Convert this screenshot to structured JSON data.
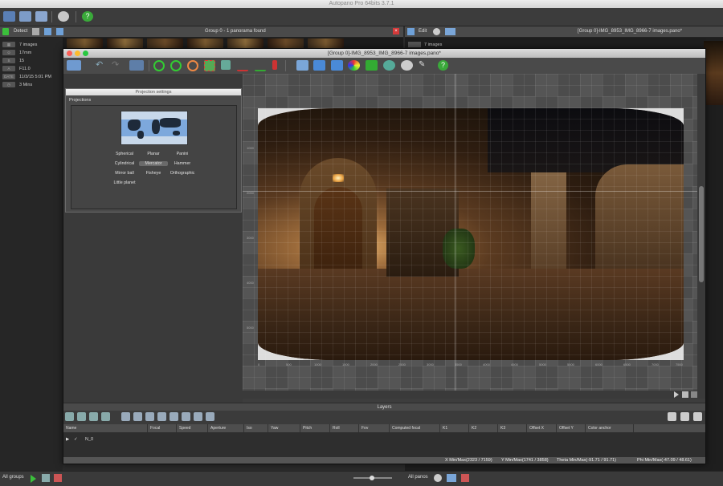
{
  "app": {
    "title": "Autopano Pro 64bits 3.7.1"
  },
  "left_pane": {
    "detect_label": "Detect",
    "group_title": "Group 0 - 1 panorama found",
    "info": [
      {
        "key": "IMG",
        "value": "7 images"
      },
      {
        "key": "F",
        "value": "17mm"
      },
      {
        "key": "ISO",
        "value": "15"
      },
      {
        "key": "f/",
        "value": "F11.0"
      },
      {
        "key": "DATE",
        "value": "11/3/15 5:01 PM"
      },
      {
        "key": "T",
        "value": "3 Mins"
      }
    ]
  },
  "right_pane": {
    "edit_label": "Edit",
    "title": "[Group 0]-IMG_8953_IMG_8966-7 images.pano*",
    "images": "7 images"
  },
  "editor": {
    "title": "[Group 0]-IMG_8953_IMG_8966-7 images.pano*"
  },
  "projection": {
    "panel_title": "Projection settings",
    "section": "Projections",
    "options": [
      "Spherical",
      "Planar",
      "Panini",
      "Cylindrical",
      "Mercator",
      "Hammer",
      "Mirror ball",
      "Fisheye",
      "Orthographic",
      "Little planet"
    ],
    "selected": "Mercator"
  },
  "layers": {
    "label": "Layers",
    "columns": [
      "Name",
      "Focal",
      "Speed",
      "Aperture",
      "Iso",
      "Yaw",
      "Pitch",
      "Roll",
      "Fov",
      "Computed focal",
      "K1",
      "K2",
      "K3",
      "Offset X",
      "Offset Y",
      "Color anchor"
    ],
    "rows": [
      {
        "name": "N_0"
      }
    ]
  },
  "status": {
    "x": "X Min/Max(2323 / 7159)",
    "y": "Y Min/Max(1741 / 3858)",
    "theta": "Theta Min/Max(-91.71 / 91.71)",
    "phi": "Phi Min/Max(-47.09 / 48.61)"
  },
  "bottom": {
    "left_label": "All groups",
    "right_label": "All panos"
  },
  "ruler": {
    "x": [
      "0",
      "500",
      "1000",
      "1500",
      "2000",
      "2500",
      "3000",
      "3500",
      "4000",
      "4500",
      "5000",
      "5500",
      "6000",
      "6500",
      "7000",
      "7500"
    ],
    "y": [
      "1000",
      "2000",
      "3000",
      "4000",
      "5000"
    ]
  }
}
